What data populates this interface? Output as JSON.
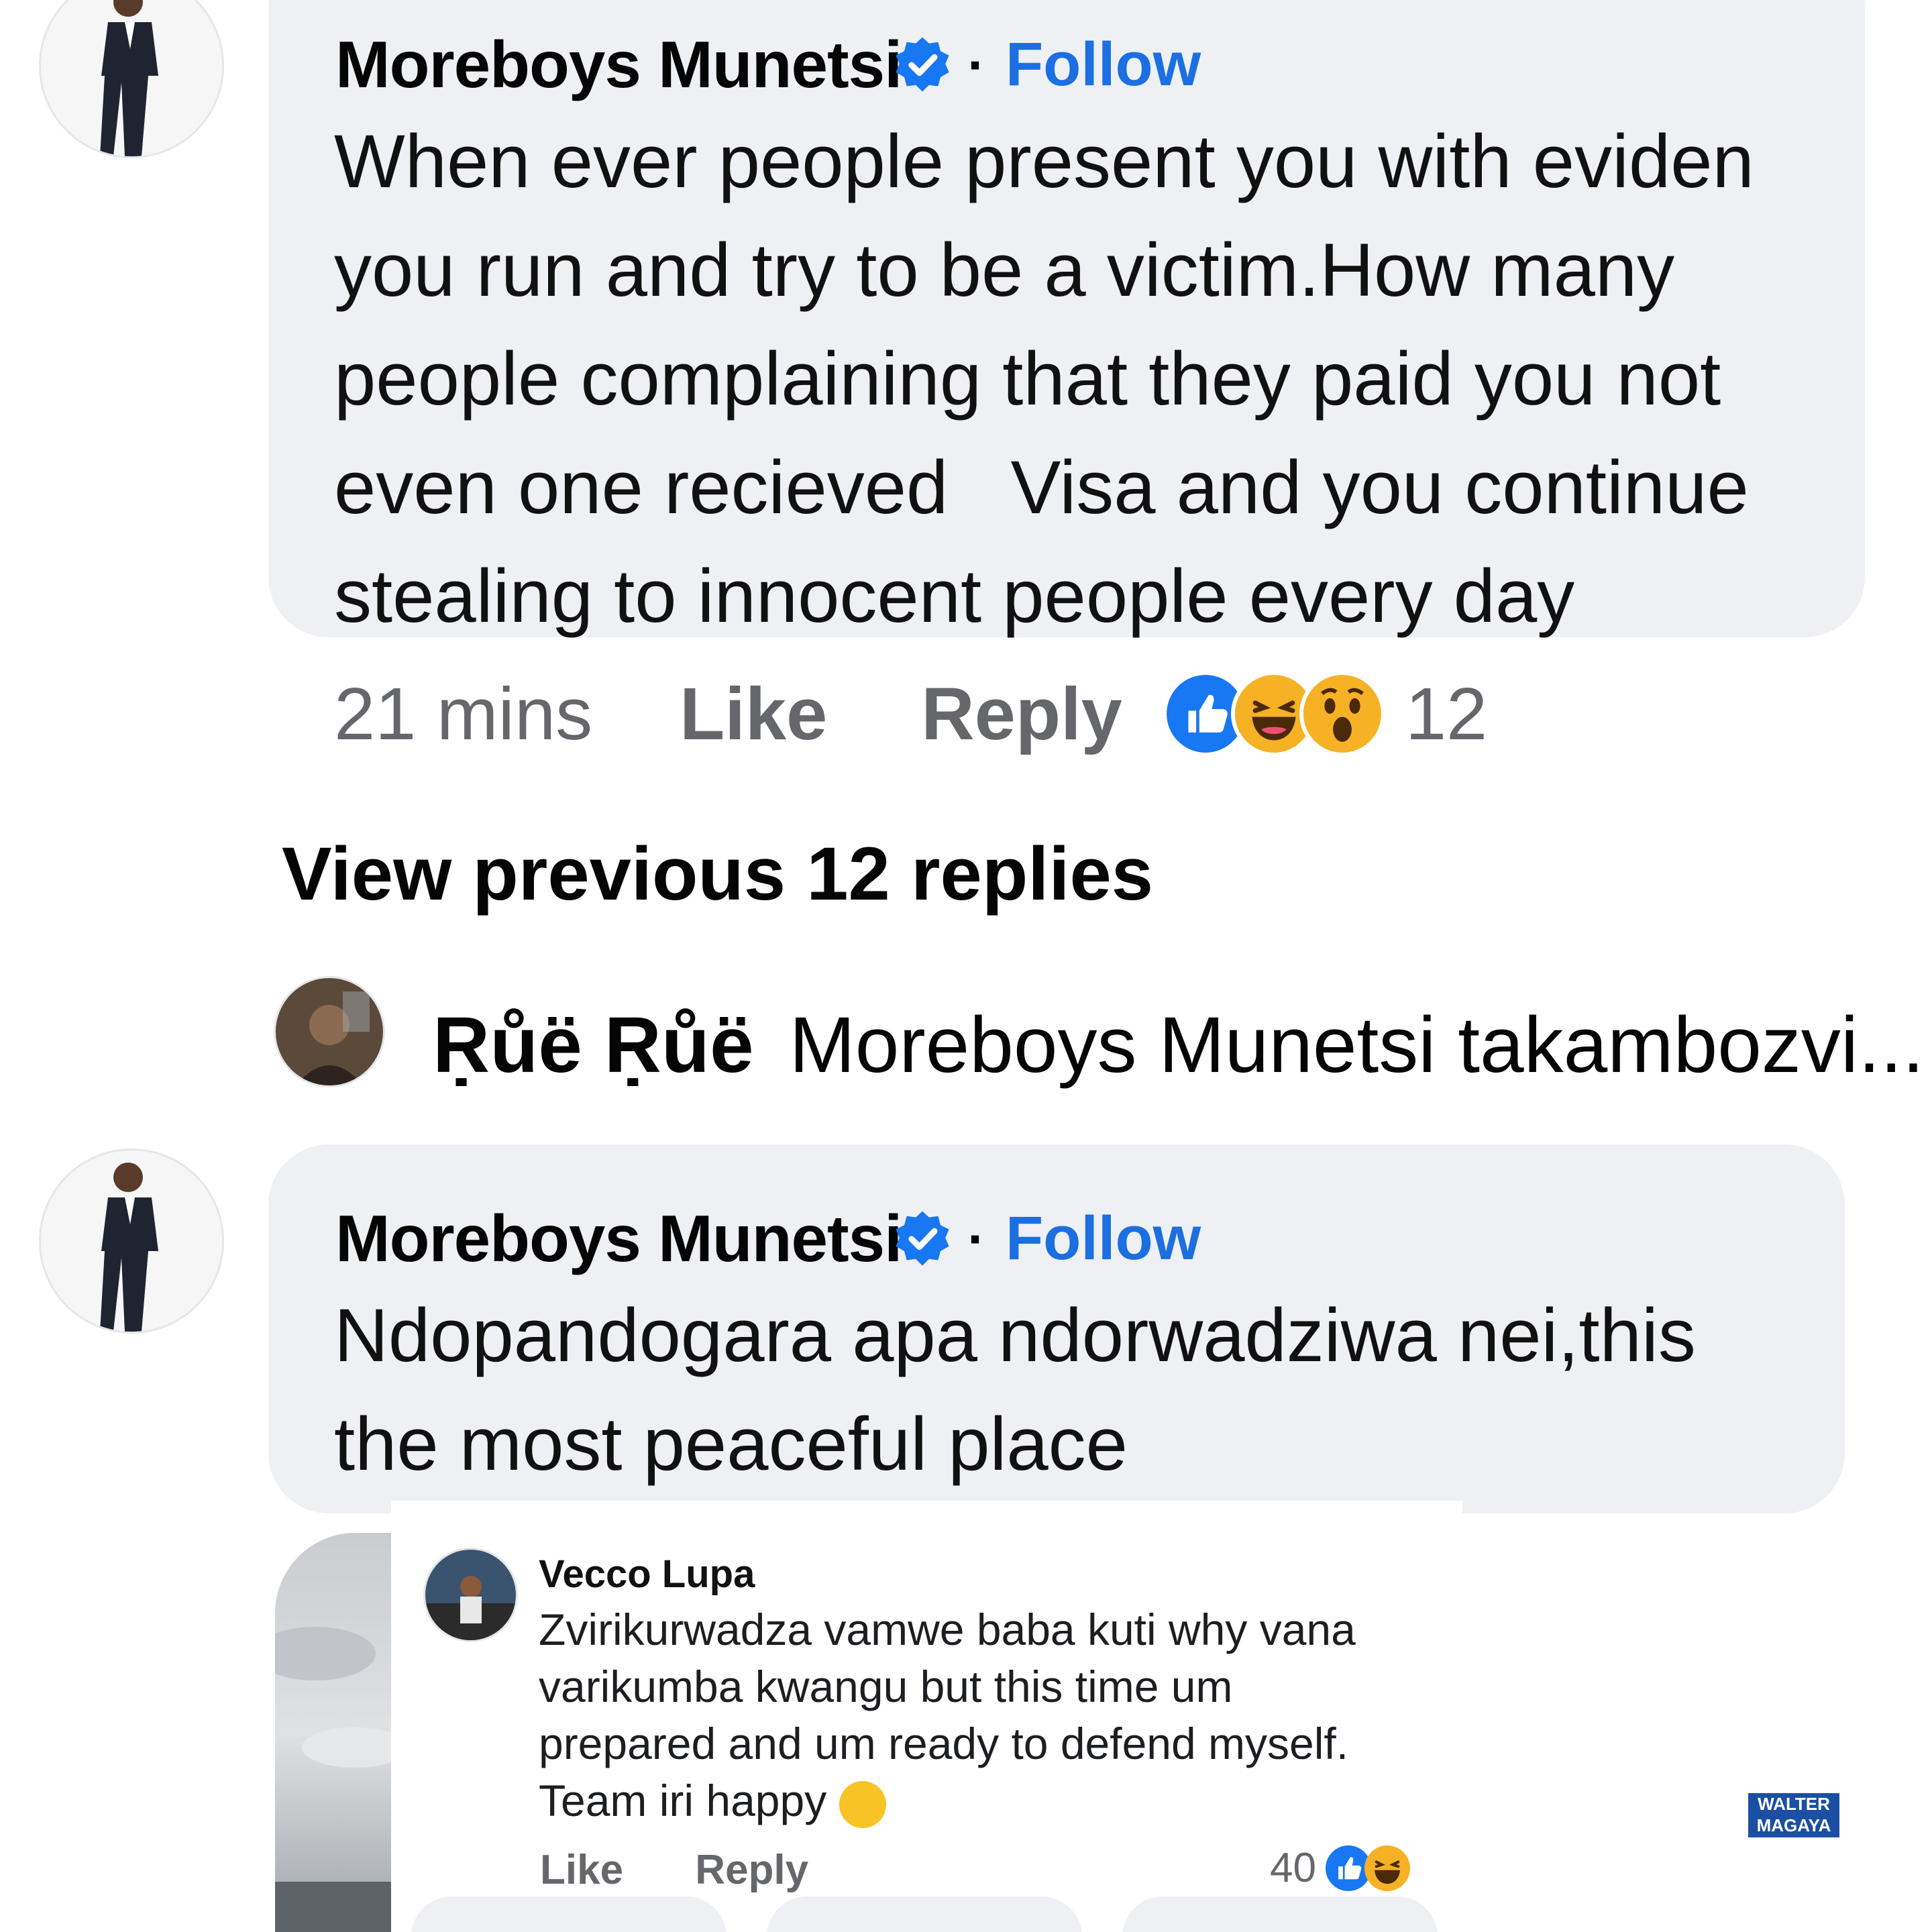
{
  "comment1": {
    "author": "Moreboys Munetsi",
    "follow": "Follow",
    "separator": "·",
    "text": "When ever people present you with eviden\nyou run and try to be a victim.How many\npeople complaining that they paid you not\neven one recieved   Visa and you continue\nstealing to innocent people every day",
    "time": "21 mins",
    "like": "Like",
    "reply": "Reply",
    "reaction_count": "12",
    "reactions": [
      "like-icon",
      "haha-icon",
      "wow-icon"
    ]
  },
  "view_previous": "View previous 12 replies",
  "reply_preview": {
    "author": "Ṛůë Ṛůë",
    "text": "Moreboys Munetsi takambozvi..."
  },
  "comment2": {
    "author": "Moreboys Munetsi",
    "follow": "Follow",
    "separator": "·",
    "text": "Ndopandogara apa ndorwadziwa nei,this\nthe most peaceful place"
  },
  "embedded": {
    "author": "Vecco Lupa",
    "text": "Zvirikurwadza vamwe baba kuti why vana\nvarikumba kwangu but this time um\nprepared and um ready to defend myself.\nTeam iri happy",
    "emoji": "😊",
    "like": "Like",
    "reply": "Reply",
    "reaction_count": "40",
    "reactions": [
      "like-icon",
      "haha-icon"
    ]
  },
  "watermark": {
    "line1": "WALTER",
    "line2": "MAGAYA"
  },
  "colors": {
    "accent": "#1b6fe0",
    "bubble": "#eef0f3",
    "muted": "#65676b"
  }
}
